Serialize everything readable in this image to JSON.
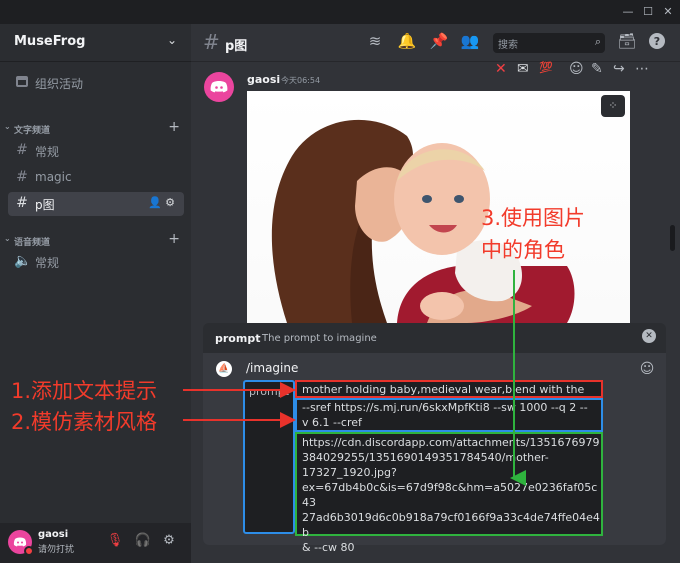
{
  "window": {
    "minimize": "—",
    "maximize": "☐",
    "close": "✕"
  },
  "server": {
    "name": "MuseFrog"
  },
  "sidebar": {
    "events": "组织活动",
    "text_category": "文字频道",
    "text_channels": [
      {
        "name": "常规"
      },
      {
        "name": "magic"
      },
      {
        "name": "p图"
      }
    ],
    "voice_category": "语音频道",
    "voice_channels": [
      {
        "name": "常规"
      }
    ]
  },
  "user": {
    "name": "gaosi",
    "status": "请勿打扰"
  },
  "header": {
    "channel": "p图",
    "search_placeholder": "搜索"
  },
  "message": {
    "author": "gaosi",
    "time": "今天06:54",
    "reaction": "💯"
  },
  "annotations": {
    "step3_line1": "3.使用图片",
    "step3_line2": "中的角色",
    "step1": "1.添加文本提示",
    "step2": "2.模仿素材风格"
  },
  "command": {
    "title": "prompt",
    "description": "The prompt to imagine",
    "name": "/imagine",
    "option_label": "prompt",
    "text_part": "mother holding baby,medieval wear,blend with the sky",
    "sref_line1": "--sref https://s.mj.run/6skxMpfKti8 --sw 1000 --q 2 --",
    "sref_line2": "v 6.1 --cref",
    "cref_text": "https://cdn.discordapp.com/attachments/1351676979\n384029255/1351690149351784540/mother-\n17327_1920.jpg?\nex=67db4b0c&is=67d9f98c&hm=a5027e0236faf05c43\n27ad6b3019d6c0b918a79cf0166f9a33c4de74ffe04e4b\n& --cw 80"
  },
  "colors": {
    "annotation_red": "#f23b2b",
    "box_red": "#e8322b",
    "box_blue": "#2d8de8",
    "box_green": "#2fb33e",
    "avatar": "#eb459e"
  }
}
